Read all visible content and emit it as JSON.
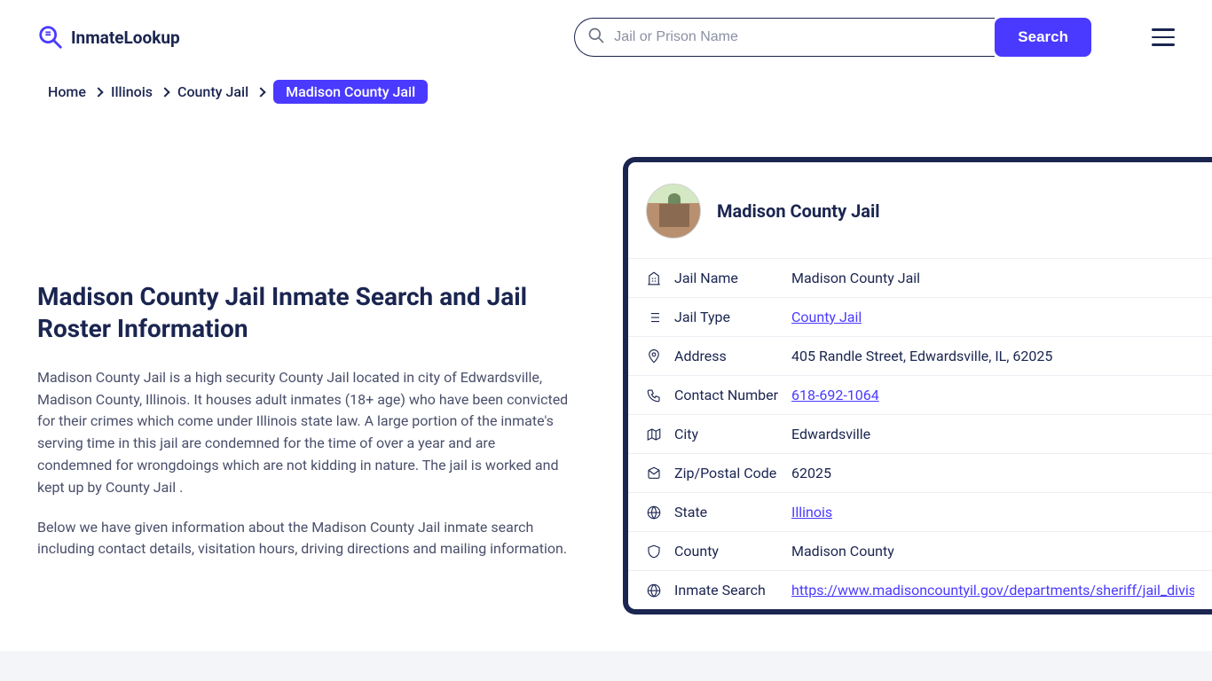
{
  "brand": {
    "name": "InmateLookup"
  },
  "search": {
    "placeholder": "Jail or Prison Name",
    "button": "Search"
  },
  "breadcrumb": {
    "items": [
      "Home",
      "Illinois",
      "County Jail"
    ],
    "current": "Madison County Jail"
  },
  "article": {
    "title": "Madison County Jail Inmate Search and Jail Roster Information",
    "p1": "Madison County Jail is a high security County Jail located in city of Edwardsville, Madison County, Illinois. It houses adult inmates (18+ age) who have been convicted for their crimes which come under Illinois state law. A large portion of the inmate's serving time in this jail are condemned for the time of over a year and are condemned for wrongdoings which are not kidding in nature. The jail is worked and kept up by County Jail .",
    "p2": "Below we have given information about the Madison County Jail inmate search including contact details, visitation hours, driving directions and mailing information."
  },
  "card": {
    "title": "Madison County Jail",
    "rows": [
      {
        "icon": "building",
        "label": "Jail Name",
        "value": "Madison County Jail",
        "link": false
      },
      {
        "icon": "list",
        "label": "Jail Type",
        "value": "County Jail",
        "link": true
      },
      {
        "icon": "pin",
        "label": "Address",
        "value": "405 Randle Street, Edwardsville, IL, 62025",
        "link": false
      },
      {
        "icon": "phone",
        "label": "Contact Number",
        "value": "618-692-1064",
        "link": true
      },
      {
        "icon": "map",
        "label": "City",
        "value": "Edwardsville",
        "link": false
      },
      {
        "icon": "mail",
        "label": "Zip/Postal Code",
        "value": "62025",
        "link": false
      },
      {
        "icon": "globe",
        "label": "State",
        "value": "Illinois",
        "link": true
      },
      {
        "icon": "shield",
        "label": "County",
        "value": "Madison County",
        "link": false
      },
      {
        "icon": "web",
        "label": "Inmate Search",
        "value": "https://www.madisoncountyil.gov/departments/sheriff/jail_divisio",
        "link": true
      }
    ]
  }
}
